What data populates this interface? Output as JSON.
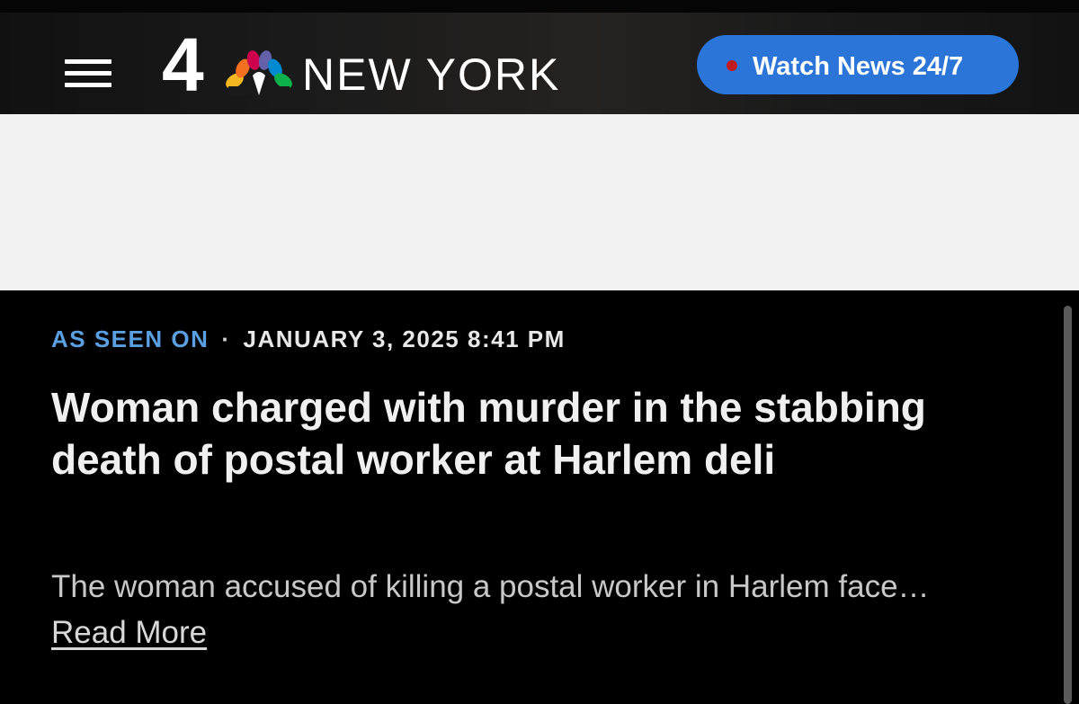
{
  "header": {
    "menu_icon": "hamburger-menu-icon",
    "logo": {
      "number": "4",
      "peacock_icon": "nbc-peacock-icon",
      "text": "NEW YORK",
      "peacock_colors": [
        "#f5b820",
        "#f37021",
        "#cc004c",
        "#6460aa",
        "#0089d0",
        "#0db14b"
      ]
    },
    "watch_button": {
      "label": "Watch News 24/7",
      "live_dot_icon": "live-dot-icon",
      "color": "#2b74d8",
      "dot_color": "#c01b1b"
    }
  },
  "article": {
    "tag": "AS SEEN ON",
    "separator": "·",
    "date": "JANUARY 3, 2025 8:41 PM",
    "headline": "Woman charged with murder in the stabbing death of postal worker at Harlem deli",
    "summary": "The woman accused of killing a postal worker in Harlem face…",
    "read_more": "Read More",
    "tag_color": "#5b9fe3"
  }
}
